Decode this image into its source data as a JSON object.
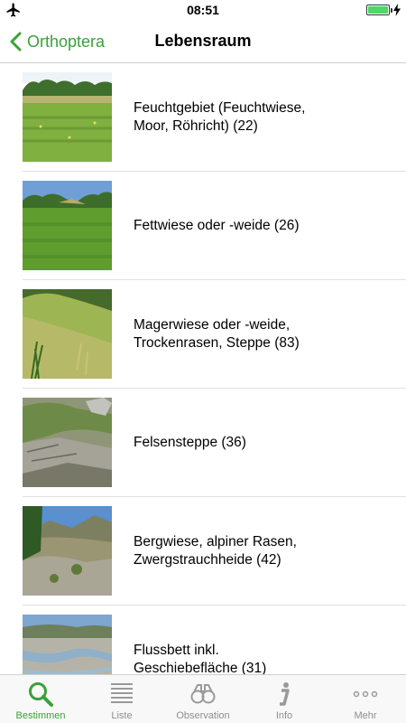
{
  "status_bar": {
    "time": "08:51",
    "icons": [
      "airplane-icon",
      "battery-icon",
      "charging-bolt-icon"
    ]
  },
  "nav": {
    "back_label": "Orthoptera",
    "title": "Lebensraum"
  },
  "habitats": [
    {
      "label": "Feuchtgebiet (Feuchtwiese, Moor, Röhricht) (22)",
      "thumb": "wetland-meadow"
    },
    {
      "label": "Fettwiese oder -weide (26)",
      "thumb": "fertile-meadow"
    },
    {
      "label": "Magerwiese oder -weide, Trockenrasen, Steppe (83)",
      "thumb": "dry-meadow"
    },
    {
      "label": "Felsensteppe (36)",
      "thumb": "rock-steppe"
    },
    {
      "label": "Bergwiese, alpiner Rasen, Zwergstrauchheide (42)",
      "thumb": "alpine-meadow"
    },
    {
      "label": "Flussbett inkl. Geschiebefläche (31)",
      "thumb": "river-bed"
    }
  ],
  "tabs": [
    {
      "label": "Bestimmen",
      "icon": "search-icon",
      "active": true
    },
    {
      "label": "Liste",
      "icon": "list-icon",
      "active": false
    },
    {
      "label": "Observation",
      "icon": "binoculars-icon",
      "active": false
    },
    {
      "label": "Info",
      "icon": "info-icon",
      "active": false
    },
    {
      "label": "Mehr",
      "icon": "more-icon",
      "active": false
    }
  ],
  "colors": {
    "accent": "#3aa13a",
    "inactive": "#8e8e8e",
    "separator": "#e0e0e0"
  }
}
